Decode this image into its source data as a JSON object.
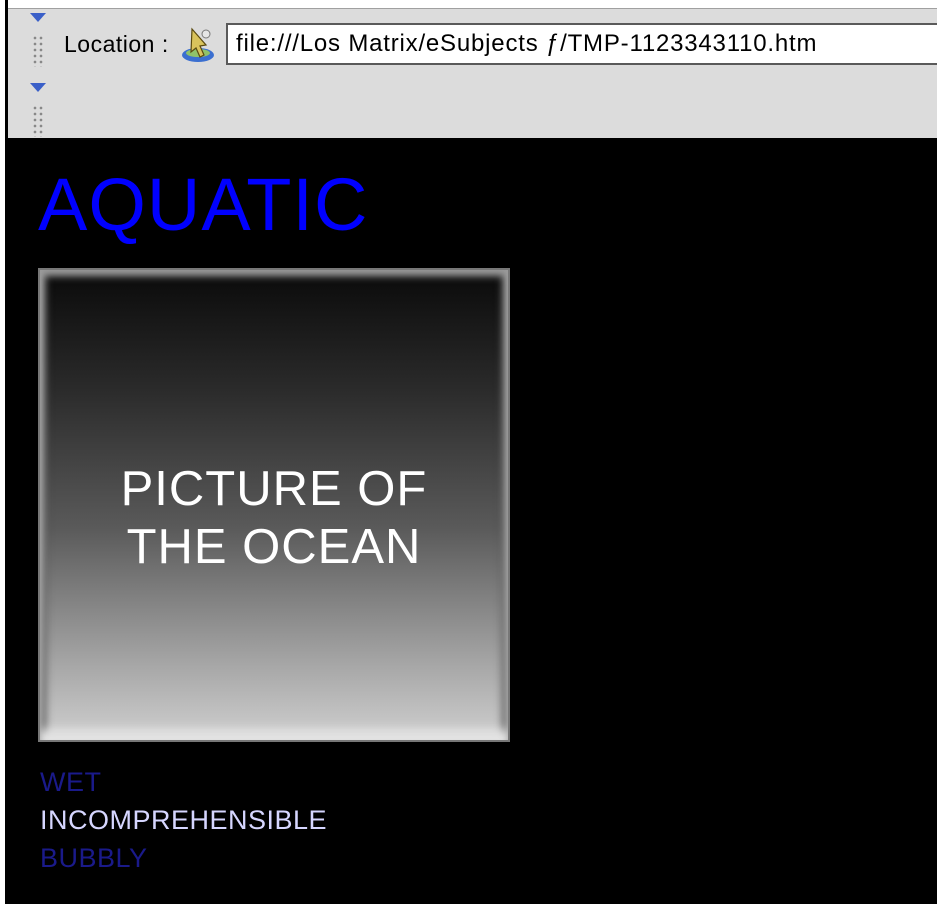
{
  "toolbar": {
    "location_label": "Location :",
    "url": "file:///Los Matrix/eSubjects ƒ/TMP-1123343110.htm",
    "location_icon": "globe-pointer-icon"
  },
  "page": {
    "title": "AQUATIC",
    "picture_caption": "PICTURE OF\nTHE OCEAN",
    "words": [
      "WET",
      "INCOMPREHENSIBLE",
      "BUBBLY"
    ]
  },
  "colors": {
    "title": "#0000ff",
    "background": "#000000",
    "word_dim": "#1a1a8a",
    "word_bright": "#d6d6ff"
  }
}
